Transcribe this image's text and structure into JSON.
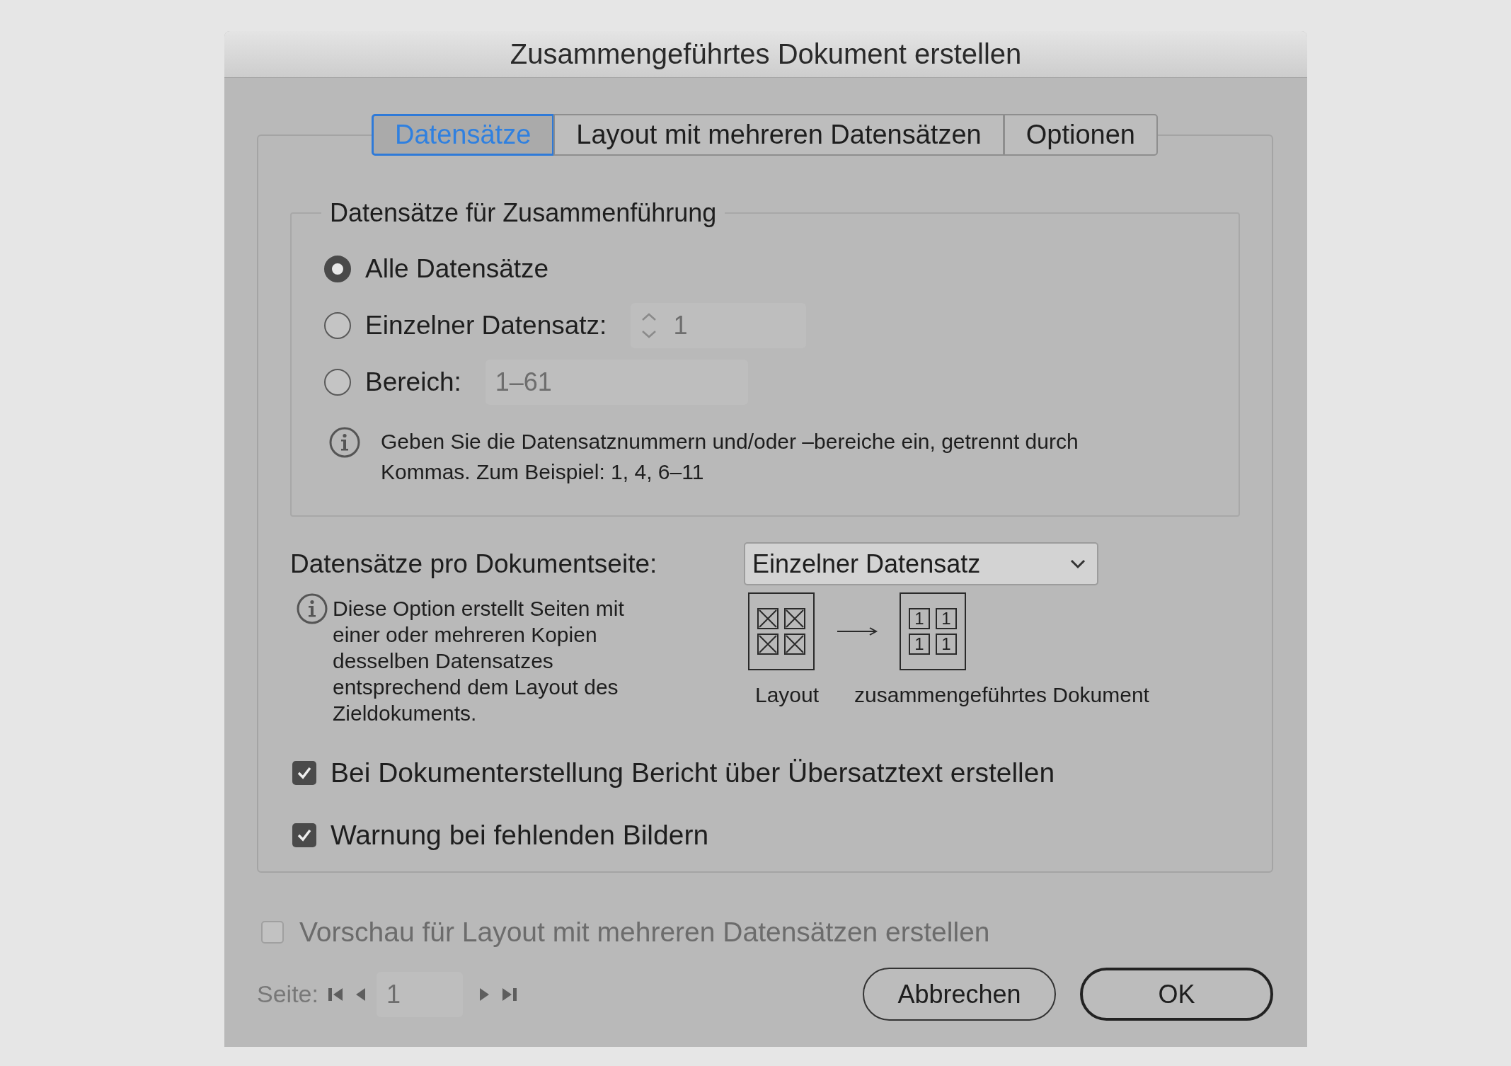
{
  "window": {
    "title": "Zusammengeführtes Dokument erstellen"
  },
  "tabs": [
    {
      "label": "Datensätze",
      "selected": true
    },
    {
      "label": "Layout mit mehreren Datensätzen",
      "selected": false
    },
    {
      "label": "Optionen",
      "selected": false
    }
  ],
  "records_group": {
    "legend": "Datensätze für Zusammenführung",
    "options": [
      {
        "kind": "plain",
        "label": "Alle Datensätze",
        "selected": true
      },
      {
        "kind": "stepper",
        "label": "Einzelner Datensatz:",
        "selected": false,
        "value": "1"
      },
      {
        "kind": "field",
        "label": "Bereich:",
        "selected": false,
        "value": "1–61"
      }
    ],
    "hint": "Geben Sie die Datensatznummern und/oder –bereiche ein, getrennt durch Kommas. Zum Beispiel: 1, 4, 6–11"
  },
  "records_per_page": {
    "label": "Datensätze pro Dokumentseite:",
    "value": "Einzelner Datensatz",
    "hint": "Diese Option erstellt Seiten mit einer oder mehreren Kopien desselben Datensatzes entsprechend dem Layout des Zieldokuments.",
    "diagram_cells": [
      "1",
      "1",
      "1",
      "1"
    ],
    "diagram_labels": [
      "Layout",
      "zusammengeführtes Dokument"
    ]
  },
  "checkboxes": [
    {
      "label": "Bei Dokumenterstellung Bericht über Übersatztext erstellen",
      "checked": true
    },
    {
      "label": "Warnung bei fehlenden Bildern",
      "checked": true
    }
  ],
  "preview": {
    "label": "Vorschau für Layout mit mehreren Datensätzen erstellen",
    "checked": false,
    "disabled": true
  },
  "pager": {
    "label": "Seite:",
    "value": "1",
    "disabled": true
  },
  "buttons": [
    {
      "label": "Abbrechen",
      "default": false
    },
    {
      "label": "OK",
      "default": true
    }
  ]
}
